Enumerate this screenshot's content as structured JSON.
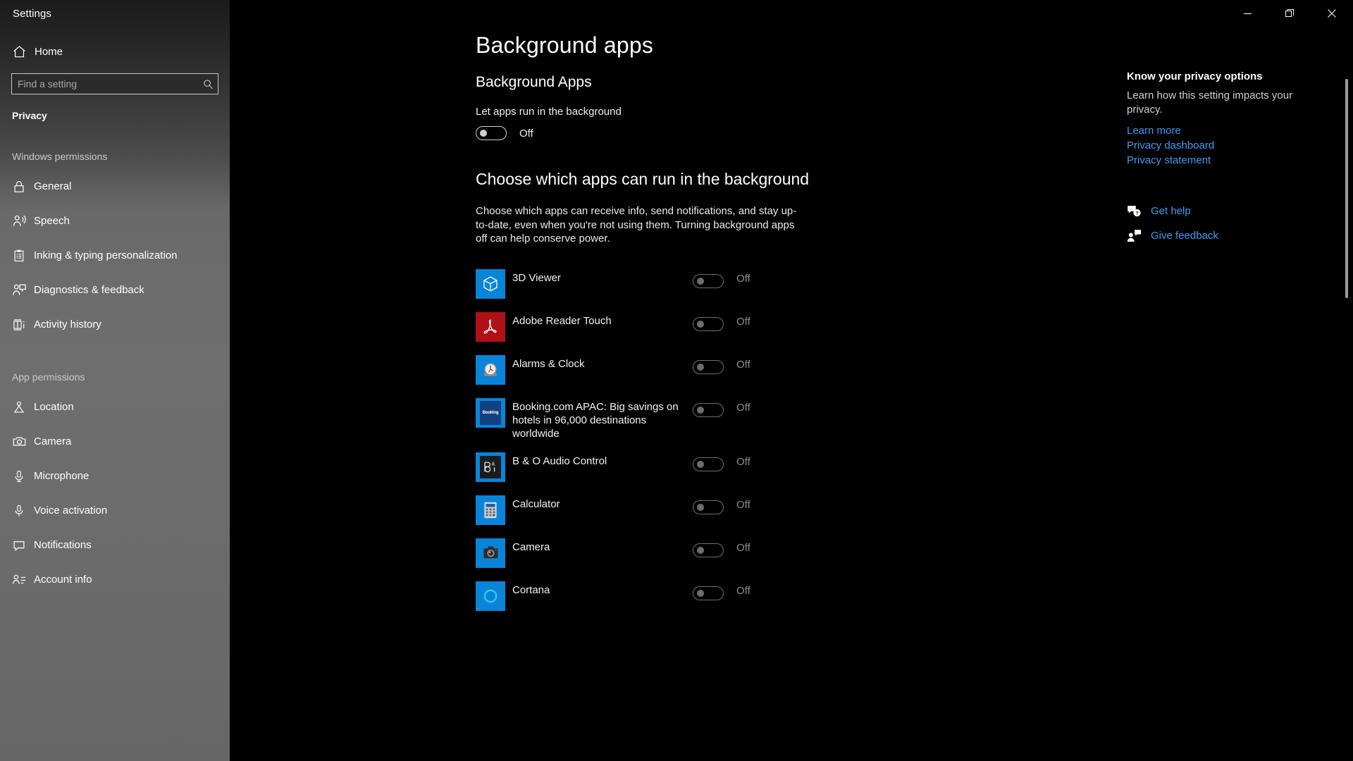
{
  "window": {
    "title": "Settings",
    "controls": {
      "minimize": "minimize-button",
      "restore": "restore-button",
      "close": "close-button"
    }
  },
  "sidebar": {
    "home_label": "Home",
    "search": {
      "placeholder": "Find a setting",
      "value": ""
    },
    "current_section": "Privacy",
    "groups": [
      {
        "heading": "Windows permissions",
        "items": [
          {
            "label": "General",
            "icon": "lock-icon"
          },
          {
            "label": "Speech",
            "icon": "speech-icon"
          },
          {
            "label": "Inking & typing personalization",
            "icon": "clipboard-icon"
          },
          {
            "label": "Diagnostics & feedback",
            "icon": "diagnostics-icon"
          },
          {
            "label": "Activity history",
            "icon": "activity-history-icon"
          }
        ]
      },
      {
        "heading": "App permissions",
        "items": [
          {
            "label": "Location",
            "icon": "location-icon"
          },
          {
            "label": "Camera",
            "icon": "camera-icon"
          },
          {
            "label": "Microphone",
            "icon": "microphone-icon"
          },
          {
            "label": "Voice activation",
            "icon": "voice-activation-icon"
          },
          {
            "label": "Notifications",
            "icon": "notifications-icon"
          },
          {
            "label": "Account info",
            "icon": "account-info-icon"
          }
        ]
      }
    ]
  },
  "main": {
    "page_title": "Background apps",
    "section_title": "Background Apps",
    "master_toggle": {
      "label": "Let apps run in the background",
      "state": "Off",
      "on": false
    },
    "choose_heading": "Choose which apps can run in the background",
    "choose_description": "Choose which apps can receive info, send notifications, and stay up-to-date, even when you're not using them. Turning background apps off can help conserve power.",
    "apps": [
      {
        "name": "3D Viewer",
        "state": "Off",
        "icon": "3d-viewer-icon"
      },
      {
        "name": "Adobe Reader Touch",
        "state": "Off",
        "icon": "adobe-reader-icon"
      },
      {
        "name": "Alarms & Clock",
        "state": "Off",
        "icon": "alarms-clock-icon"
      },
      {
        "name": "Booking.com APAC: Big savings on hotels in 96,000 destinations worldwide",
        "state": "Off",
        "icon": "booking-icon"
      },
      {
        "name": "B & O Audio Control",
        "state": "Off",
        "icon": "bo-audio-icon"
      },
      {
        "name": "Calculator",
        "state": "Off",
        "icon": "calculator-icon"
      },
      {
        "name": "Camera",
        "state": "Off",
        "icon": "camera-app-icon"
      },
      {
        "name": "Cortana",
        "state": "Off",
        "icon": "cortana-icon"
      }
    ]
  },
  "rail": {
    "heading": "Know your privacy options",
    "description": "Learn how this setting impacts your privacy.",
    "links": [
      "Learn more",
      "Privacy dashboard",
      "Privacy statement"
    ],
    "help": [
      {
        "label": "Get help",
        "icon": "get-help-icon"
      },
      {
        "label": "Give feedback",
        "icon": "give-feedback-icon"
      }
    ]
  },
  "colors": {
    "link": "#3d9bf0",
    "accent_blue": "#0078d7",
    "adobe_red": "#b01116",
    "booking_navy": "#13407f"
  }
}
